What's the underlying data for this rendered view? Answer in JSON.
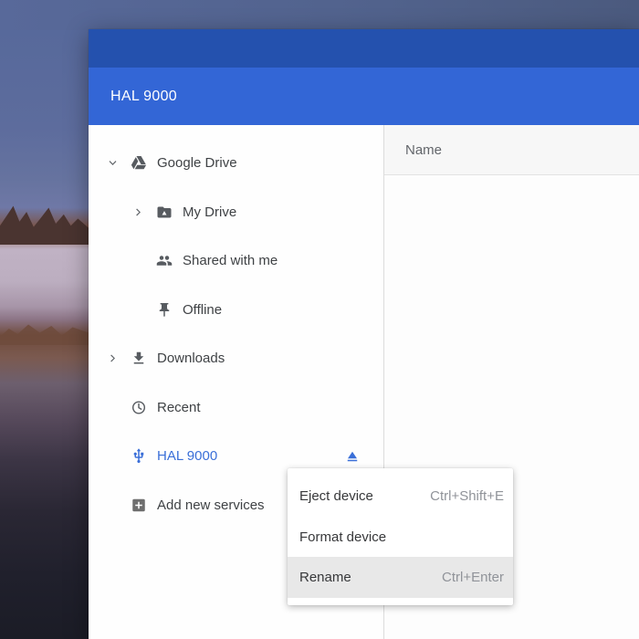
{
  "window": {
    "title": "HAL 9000"
  },
  "main": {
    "columns": [
      {
        "label": "Name"
      }
    ]
  },
  "sidebar": {
    "items": [
      {
        "label": "Google Drive",
        "icon": "google-drive",
        "chevron": "down",
        "level": 0,
        "selected": false,
        "eject_button": false
      },
      {
        "label": "My Drive",
        "icon": "drive-folder",
        "chevron": "right",
        "level": 1,
        "selected": false,
        "eject_button": false
      },
      {
        "label": "Shared with me",
        "icon": "people",
        "chevron": "",
        "level": 1,
        "selected": false,
        "eject_button": false
      },
      {
        "label": "Offline",
        "icon": "pin",
        "chevron": "",
        "level": 1,
        "selected": false,
        "eject_button": false
      },
      {
        "label": "Downloads",
        "icon": "download",
        "chevron": "right",
        "level": 0,
        "selected": false,
        "eject_button": false
      },
      {
        "label": "Recent",
        "icon": "clock",
        "chevron": "",
        "level": 0,
        "selected": false,
        "eject_button": false
      },
      {
        "label": "HAL 9000",
        "icon": "usb",
        "chevron": "",
        "level": 0,
        "selected": true,
        "eject_button": true
      },
      {
        "label": "Add new services",
        "icon": "plus-square",
        "chevron": "",
        "level": 0,
        "selected": false,
        "eject_button": false
      }
    ]
  },
  "context_menu": {
    "items": [
      {
        "label": "Eject device",
        "shortcut": "Ctrl+Shift+E",
        "highlighted": false
      },
      {
        "label": "Format device",
        "shortcut": "",
        "highlighted": false
      },
      {
        "label": "Rename",
        "shortcut": "Ctrl+Enter",
        "highlighted": true
      }
    ]
  },
  "colors": {
    "titlebar": "#2451ae",
    "appbar": "#3366d6",
    "accent_blue": "#3a6fd8",
    "menu_highlight": "#e8e8e8"
  }
}
